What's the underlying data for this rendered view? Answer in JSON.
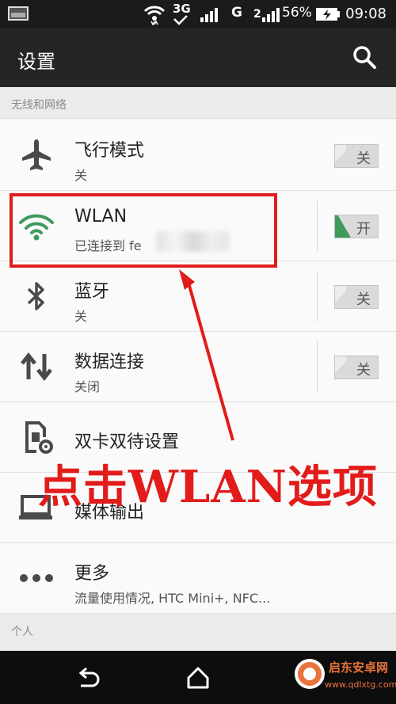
{
  "statusbar": {
    "network_3g": "3G",
    "network_g": "G",
    "network_2": "2",
    "battery": "56%",
    "time": "09:08"
  },
  "header": {
    "title": "设置"
  },
  "sections": {
    "wireless": "无线和网络",
    "personal": "个人"
  },
  "items": [
    {
      "title": "飞行模式",
      "subtitle": "关",
      "toggle": "关",
      "icon": "airplane-icon"
    },
    {
      "title": "WLAN",
      "subtitle": "已连接到 fe",
      "toggle": "开",
      "icon": "wifi-icon"
    },
    {
      "title": "蓝牙",
      "subtitle": "关",
      "toggle": "关",
      "icon": "bluetooth-icon"
    },
    {
      "title": "数据连接",
      "subtitle": "关闭",
      "toggle": "关",
      "icon": "data-arrows-icon"
    },
    {
      "title": "双卡双待设置",
      "subtitle": "",
      "icon": "sim-gear-icon"
    },
    {
      "title": "媒体输出",
      "subtitle": "",
      "icon": "media-output-icon"
    },
    {
      "title": "更多",
      "subtitle": "流量使用情况, HTC Mini+, NFC...",
      "icon": "more-dots-icon"
    }
  ],
  "annotation": {
    "text": "点击WLAN选项"
  },
  "watermark": {
    "name": "启东安卓网",
    "url": "www.qdlxtg.com"
  },
  "colors": {
    "accent_red": "#e21b1b",
    "toggle_on": "#3e9a5a",
    "wifi_green": "#3e9a5a"
  }
}
